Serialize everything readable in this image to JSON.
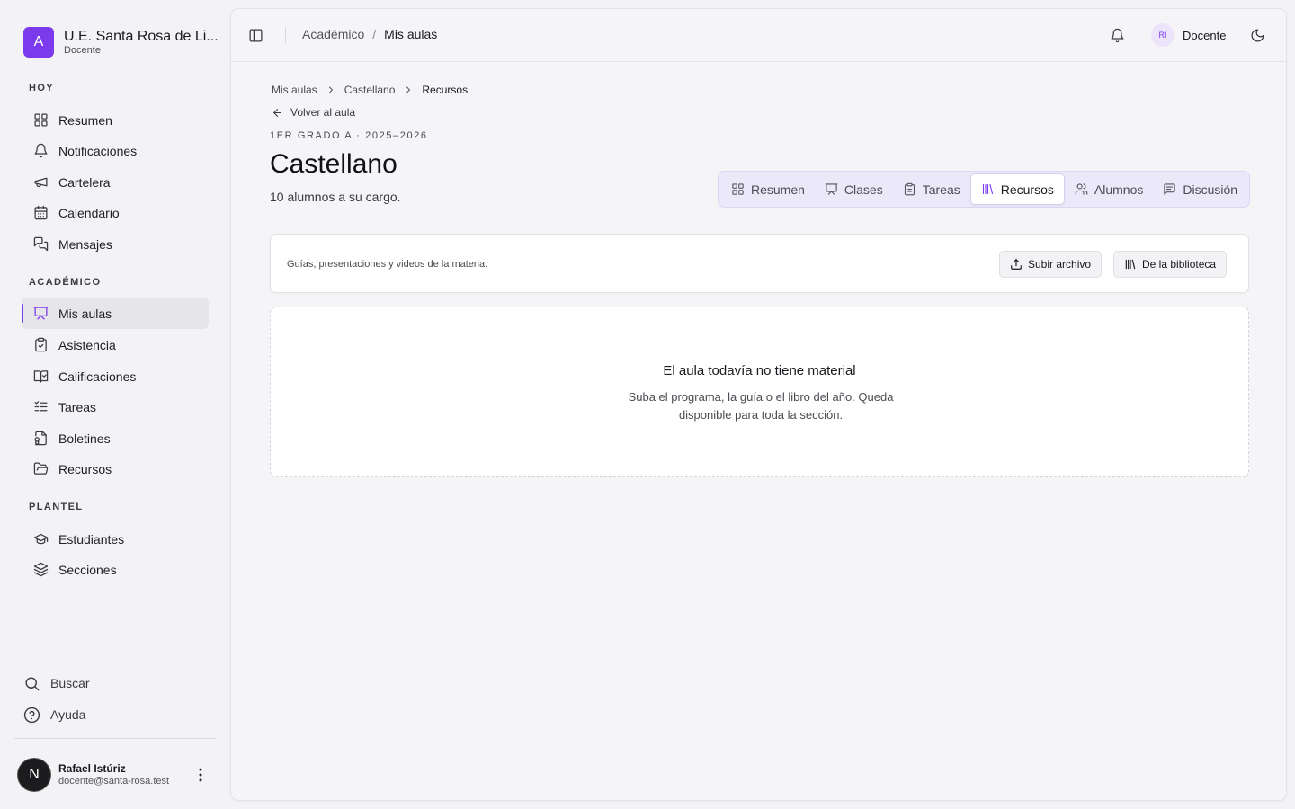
{
  "brand": {
    "logo_letter": "A",
    "name": "U.E. Santa Rosa de Li...",
    "role": "Docente",
    "accent": "#7c3aed"
  },
  "sidebar": {
    "sections": [
      {
        "label": "HOY"
      },
      {
        "label": "ACADÉMICO"
      },
      {
        "label": "PLANTEL"
      }
    ],
    "items": [
      {
        "label": "Resumen",
        "icon": "grid-icon"
      },
      {
        "label": "Notificaciones",
        "icon": "bell-icon"
      },
      {
        "label": "Cartelera",
        "icon": "megaphone-icon"
      },
      {
        "label": "Calendario",
        "icon": "calendar-icon"
      },
      {
        "label": "Mensajes",
        "icon": "messages-icon"
      },
      {
        "label": "Mis aulas",
        "icon": "presentation-icon",
        "active": true
      },
      {
        "label": "Asistencia",
        "icon": "clipboard-check-icon"
      },
      {
        "label": "Calificaciones",
        "icon": "book-check-icon"
      },
      {
        "label": "Tareas",
        "icon": "list-todo-icon"
      },
      {
        "label": "Boletines",
        "icon": "file-report-icon"
      },
      {
        "label": "Recursos",
        "icon": "folder-open-icon"
      },
      {
        "label": "Estudiantes",
        "icon": "graduation-cap-icon"
      },
      {
        "label": "Secciones",
        "icon": "layers-icon"
      }
    ],
    "utility": [
      {
        "label": "Buscar",
        "icon": "search-icon"
      },
      {
        "label": "Ayuda",
        "icon": "help-circle-icon"
      }
    ],
    "user": {
      "avatar_letter": "N",
      "name": "Rafael Istúriz",
      "email": "docente@santa-rosa.test"
    }
  },
  "topbar": {
    "breadcrumb": [
      "Académico",
      "Mis aulas"
    ],
    "user_initials": "RI",
    "user_label": "Docente"
  },
  "content": {
    "breadcrumb": [
      "Mis aulas",
      "Castellano",
      "Recursos"
    ],
    "back_label": "Volver al aula",
    "eyebrow": "1ER GRADO A · 2025–2026",
    "title": "Castellano",
    "subtitle": "10 alumnos a su cargo.",
    "tabs": [
      {
        "label": "Resumen",
        "icon": "grid-icon"
      },
      {
        "label": "Clases",
        "icon": "presentation-icon"
      },
      {
        "label": "Tareas",
        "icon": "clipboard-icon"
      },
      {
        "label": "Recursos",
        "icon": "library-icon",
        "active": true
      },
      {
        "label": "Alumnos",
        "icon": "users-icon"
      },
      {
        "label": "Discusión",
        "icon": "message-square-icon"
      }
    ],
    "toolbar": {
      "description": "Guías, presentaciones y videos de la materia.",
      "upload_label": "Subir archivo",
      "library_label": "De la biblioteca"
    },
    "empty": {
      "title": "El aula todavía no tiene material",
      "description": "Suba el programa, la guía o el libro del año. Queda disponible para toda la sección."
    }
  }
}
